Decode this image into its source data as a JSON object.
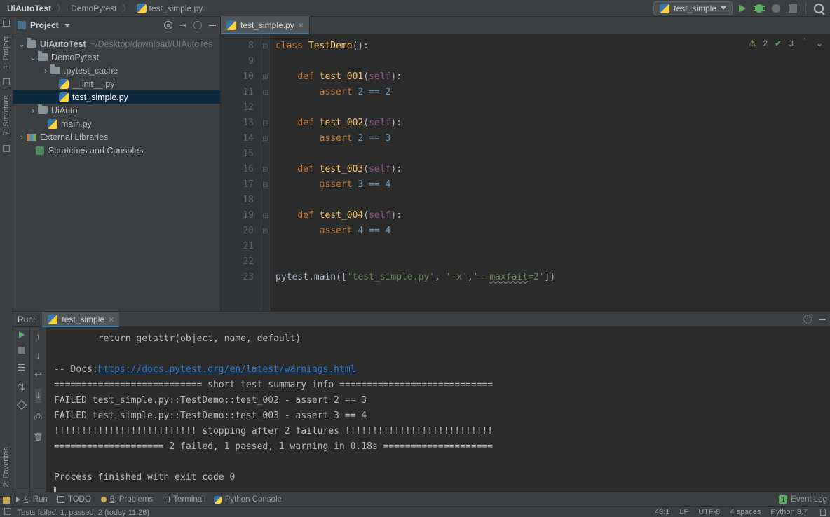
{
  "breadcrumbs": {
    "root": "UiAutoTest",
    "mid": "DemoPytest",
    "file": "test_simple.py"
  },
  "run_config": {
    "name": "test_simple"
  },
  "inspections": {
    "warnings": "2",
    "oks": "3"
  },
  "project": {
    "title": "Project",
    "root": "UiAutoTest",
    "root_hint": "~/Desktop/download/UIAutoTes",
    "items": {
      "demopytest": "DemoPytest",
      "cache": ".pytest_cache",
      "init": "__init__.py",
      "testfile": "test_simple.py",
      "uiauto": "UiAuto",
      "main": "main.py",
      "extlib": "External Libraries",
      "scratches": "Scratches and Consoles"
    }
  },
  "leftrail": {
    "project": "1: Project",
    "structure": "7: Structure",
    "favorites": "2: Favorites"
  },
  "tabs": {
    "active": "test_simple.py"
  },
  "code": {
    "lines": [
      "8",
      "9",
      "10",
      "11",
      "12",
      "13",
      "14",
      "15",
      "16",
      "17",
      "18",
      "19",
      "20",
      "21",
      "22",
      "23"
    ],
    "cls": "TestDemo",
    "class_kw": "class",
    "def_kw": "def",
    "assert_kw": "assert",
    "self_kw": "self",
    "t1": "test_001",
    "t2": "test_002",
    "t3": "test_003",
    "t4": "test_004",
    "a1": "2 == 2",
    "a2": "2 == 3",
    "a3": "3 == 4",
    "a4": "4 == 4",
    "pycall": "pytest.main([",
    "arg1": "'test_simple.py'",
    "arg2": "'-x'",
    "arg3_pre": "'--",
    "arg3_u": "maxfail",
    "arg3_post": "=2'",
    "pycall_end": "])"
  },
  "run": {
    "label": "Run:",
    "tab": "test_simple",
    "lines": {
      "getattr": "        return getattr(object, name, default)",
      "docs_pre": "-- Docs:",
      "docs_url": "https://docs.pytest.org/en/latest/warnings.html",
      "summary_hdr": "=========================== short test summary info ============================",
      "fail1": "FAILED test_simple.py::TestDemo::test_002 - assert 2 == 3",
      "fail2": "FAILED test_simple.py::TestDemo::test_003 - assert 3 == 4",
      "stopping": "!!!!!!!!!!!!!!!!!!!!!!!!!! stopping after 2 failures !!!!!!!!!!!!!!!!!!!!!!!!!!!",
      "totals": "==================== 2 failed, 1 passed, 1 warning in 0.18s ====================",
      "exit": "Process finished with exit code 0"
    }
  },
  "bottom": {
    "run": "4: Run",
    "todo": "TODO",
    "problems": "6: Problems",
    "terminal": "Terminal",
    "pyconsole": "Python Console",
    "eventlog": "Event Log"
  },
  "status": {
    "left": "Tests failed: 1, passed: 2 (today 11:26)",
    "caret": "43:1",
    "le": "LF",
    "enc": "UTF-8",
    "indent": "4 spaces",
    "interp": "Python 3.7"
  }
}
